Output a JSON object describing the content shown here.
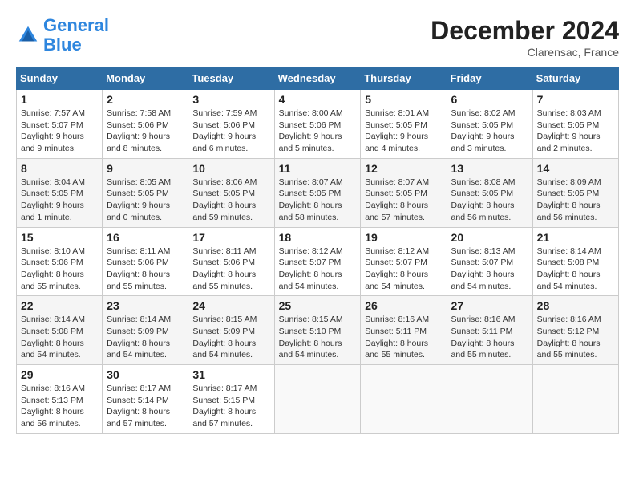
{
  "header": {
    "logo_line1": "General",
    "logo_line2": "Blue",
    "month_title": "December 2024",
    "location": "Clarensac, France"
  },
  "weekdays": [
    "Sunday",
    "Monday",
    "Tuesday",
    "Wednesday",
    "Thursday",
    "Friday",
    "Saturday"
  ],
  "weeks": [
    [
      {
        "day": "1",
        "info": "Sunrise: 7:57 AM\nSunset: 5:07 PM\nDaylight: 9 hours and 9 minutes."
      },
      {
        "day": "2",
        "info": "Sunrise: 7:58 AM\nSunset: 5:06 PM\nDaylight: 9 hours and 8 minutes."
      },
      {
        "day": "3",
        "info": "Sunrise: 7:59 AM\nSunset: 5:06 PM\nDaylight: 9 hours and 6 minutes."
      },
      {
        "day": "4",
        "info": "Sunrise: 8:00 AM\nSunset: 5:06 PM\nDaylight: 9 hours and 5 minutes."
      },
      {
        "day": "5",
        "info": "Sunrise: 8:01 AM\nSunset: 5:05 PM\nDaylight: 9 hours and 4 minutes."
      },
      {
        "day": "6",
        "info": "Sunrise: 8:02 AM\nSunset: 5:05 PM\nDaylight: 9 hours and 3 minutes."
      },
      {
        "day": "7",
        "info": "Sunrise: 8:03 AM\nSunset: 5:05 PM\nDaylight: 9 hours and 2 minutes."
      }
    ],
    [
      {
        "day": "8",
        "info": "Sunrise: 8:04 AM\nSunset: 5:05 PM\nDaylight: 9 hours and 1 minute."
      },
      {
        "day": "9",
        "info": "Sunrise: 8:05 AM\nSunset: 5:05 PM\nDaylight: 9 hours and 0 minutes."
      },
      {
        "day": "10",
        "info": "Sunrise: 8:06 AM\nSunset: 5:05 PM\nDaylight: 8 hours and 59 minutes."
      },
      {
        "day": "11",
        "info": "Sunrise: 8:07 AM\nSunset: 5:05 PM\nDaylight: 8 hours and 58 minutes."
      },
      {
        "day": "12",
        "info": "Sunrise: 8:07 AM\nSunset: 5:05 PM\nDaylight: 8 hours and 57 minutes."
      },
      {
        "day": "13",
        "info": "Sunrise: 8:08 AM\nSunset: 5:05 PM\nDaylight: 8 hours and 56 minutes."
      },
      {
        "day": "14",
        "info": "Sunrise: 8:09 AM\nSunset: 5:05 PM\nDaylight: 8 hours and 56 minutes."
      }
    ],
    [
      {
        "day": "15",
        "info": "Sunrise: 8:10 AM\nSunset: 5:06 PM\nDaylight: 8 hours and 55 minutes."
      },
      {
        "day": "16",
        "info": "Sunrise: 8:11 AM\nSunset: 5:06 PM\nDaylight: 8 hours and 55 minutes."
      },
      {
        "day": "17",
        "info": "Sunrise: 8:11 AM\nSunset: 5:06 PM\nDaylight: 8 hours and 55 minutes."
      },
      {
        "day": "18",
        "info": "Sunrise: 8:12 AM\nSunset: 5:07 PM\nDaylight: 8 hours and 54 minutes."
      },
      {
        "day": "19",
        "info": "Sunrise: 8:12 AM\nSunset: 5:07 PM\nDaylight: 8 hours and 54 minutes."
      },
      {
        "day": "20",
        "info": "Sunrise: 8:13 AM\nSunset: 5:07 PM\nDaylight: 8 hours and 54 minutes."
      },
      {
        "day": "21",
        "info": "Sunrise: 8:14 AM\nSunset: 5:08 PM\nDaylight: 8 hours and 54 minutes."
      }
    ],
    [
      {
        "day": "22",
        "info": "Sunrise: 8:14 AM\nSunset: 5:08 PM\nDaylight: 8 hours and 54 minutes."
      },
      {
        "day": "23",
        "info": "Sunrise: 8:14 AM\nSunset: 5:09 PM\nDaylight: 8 hours and 54 minutes."
      },
      {
        "day": "24",
        "info": "Sunrise: 8:15 AM\nSunset: 5:09 PM\nDaylight: 8 hours and 54 minutes."
      },
      {
        "day": "25",
        "info": "Sunrise: 8:15 AM\nSunset: 5:10 PM\nDaylight: 8 hours and 54 minutes."
      },
      {
        "day": "26",
        "info": "Sunrise: 8:16 AM\nSunset: 5:11 PM\nDaylight: 8 hours and 55 minutes."
      },
      {
        "day": "27",
        "info": "Sunrise: 8:16 AM\nSunset: 5:11 PM\nDaylight: 8 hours and 55 minutes."
      },
      {
        "day": "28",
        "info": "Sunrise: 8:16 AM\nSunset: 5:12 PM\nDaylight: 8 hours and 55 minutes."
      }
    ],
    [
      {
        "day": "29",
        "info": "Sunrise: 8:16 AM\nSunset: 5:13 PM\nDaylight: 8 hours and 56 minutes."
      },
      {
        "day": "30",
        "info": "Sunrise: 8:17 AM\nSunset: 5:14 PM\nDaylight: 8 hours and 57 minutes."
      },
      {
        "day": "31",
        "info": "Sunrise: 8:17 AM\nSunset: 5:15 PM\nDaylight: 8 hours and 57 minutes."
      },
      null,
      null,
      null,
      null
    ]
  ]
}
